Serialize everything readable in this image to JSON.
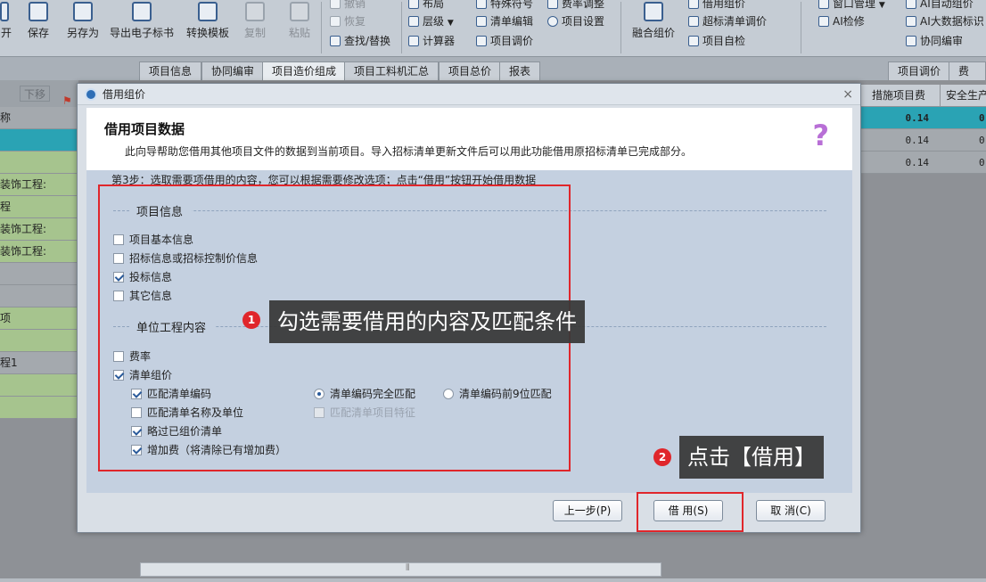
{
  "ribbon": {
    "big_buttons": [
      {
        "label": "开",
        "icon": "open-icon",
        "disabled": false
      },
      {
        "label": "保存",
        "icon": "save-icon",
        "disabled": false
      },
      {
        "label": "另存为",
        "icon": "save-as-icon",
        "disabled": false
      },
      {
        "label": "导出电子标书",
        "icon": "export-icon",
        "disabled": false
      },
      {
        "label": "转换模板",
        "icon": "convert-icon",
        "disabled": false
      },
      {
        "label": "复制",
        "icon": "copy-icon",
        "disabled": true
      },
      {
        "label": "粘贴",
        "icon": "paste-icon",
        "disabled": true
      },
      {
        "label": "融合组价",
        "icon": "merge-icon",
        "disabled": false
      }
    ],
    "small_buttons": [
      {
        "label": "撤销",
        "icon": "undo-icon",
        "disabled": true
      },
      {
        "label": "恢复",
        "icon": "redo-icon",
        "disabled": true
      },
      {
        "label": "查找/替换",
        "icon": "find-icon",
        "disabled": false
      },
      {
        "label": "布局",
        "icon": "layout-icon",
        "disabled": false
      },
      {
        "label": "层级",
        "icon": "level-icon",
        "disabled": false
      },
      {
        "label": "计算器",
        "icon": "calculator-icon",
        "disabled": false
      },
      {
        "label": "特殊符号",
        "icon": "symbol-icon",
        "disabled": false
      },
      {
        "label": "清单编辑",
        "icon": "list-edit-icon",
        "disabled": false
      },
      {
        "label": "项目调价",
        "icon": "price-adjust-icon",
        "disabled": false
      },
      {
        "label": "费率调整",
        "icon": "rate-icon",
        "disabled": false
      },
      {
        "label": "项目设置",
        "icon": "settings-icon",
        "disabled": false
      },
      {
        "label": "借用组价",
        "icon": "borrow-icon",
        "disabled": false
      },
      {
        "label": "超标清单调价",
        "icon": "over-limit-icon",
        "disabled": false
      },
      {
        "label": "项目自检",
        "icon": "check-icon",
        "disabled": false
      },
      {
        "label": "窗口管理",
        "icon": "window-icon",
        "disabled": false
      },
      {
        "label": "AI检修",
        "icon": "ai-repair-icon",
        "disabled": false
      },
      {
        "label": "AI自动组价",
        "icon": "ai-auto-icon",
        "disabled": false
      },
      {
        "label": "AI大数据标识",
        "icon": "ai-data-icon",
        "disabled": false
      },
      {
        "label": "协同编审",
        "icon": "collab-icon",
        "disabled": false
      }
    ]
  },
  "tabs": [
    "项目信息",
    "协同编审",
    "项目造价组成",
    "项目工料机汇总",
    "项目总价",
    "报表"
  ],
  "active_tab_index": 2,
  "right_tabs": [
    "项目调价",
    "费率"
  ],
  "background": {
    "toolbar_label": "下移",
    "left_rows": [
      "称",
      "",
      "",
      "装饰工程:",
      "程",
      "装饰工程:",
      "装饰工程:",
      "",
      "",
      "项",
      "",
      "程1",
      "",
      ""
    ],
    "right_headers": [
      "措施项目费",
      "安全生产"
    ],
    "right_values": [
      "0.14",
      "0.14",
      "0.14"
    ],
    "right_partial": [
      "0",
      "0",
      "0"
    ]
  },
  "dialog": {
    "title": "借用组价",
    "close": "×",
    "header_title": "借用项目数据",
    "header_desc": "此向导帮助您借用其他项目文件的数据到当前项目。导入招标清单更新文件后可以用此功能借用原招标清单已完成部分。",
    "help": "?",
    "step_text": "第3步：选取需要项借用的内容，您可以根据需要修改选项；点击“借用”按钮开始借用数据",
    "section1": "项目信息",
    "section1_items": [
      {
        "label": "项目基本信息",
        "checked": false
      },
      {
        "label": "招标信息或招标控制价信息",
        "checked": false
      },
      {
        "label": "投标信息",
        "checked": true
      },
      {
        "label": "其它信息",
        "checked": false
      }
    ],
    "section2": "单位工程内容",
    "rate": {
      "label": "费率",
      "checked": false
    },
    "list": {
      "label": "清单组价",
      "checked": true
    },
    "list_options": [
      {
        "label": "匹配清单编码",
        "checked": true
      },
      {
        "label": "匹配清单名称及单位",
        "checked": false
      },
      {
        "label": "略过已组价清单",
        "checked": true
      },
      {
        "label": "增加费（将清除已有增加费）",
        "checked": true
      }
    ],
    "match_radios": [
      {
        "label": "清单编码完全匹配",
        "selected": true
      },
      {
        "label": "清单编码前9位匹配",
        "selected": false
      }
    ],
    "feature_option": {
      "label": "匹配清单项目特征",
      "checked": false
    },
    "buttons": {
      "prev": "上一步(P)",
      "borrow": "借 用(S)",
      "cancel": "取 消(C)"
    }
  },
  "annotations": {
    "callout1_num": "1",
    "callout1": "勾选需要借用的内容及匹配条件",
    "callout2_num": "2",
    "callout2": "点击【借用】"
  },
  "colors": {
    "annotation_red": "#e0262b",
    "callout_bg": "#383838",
    "header_teal": "#2aa3b4",
    "row_green": "#a6c48e"
  }
}
